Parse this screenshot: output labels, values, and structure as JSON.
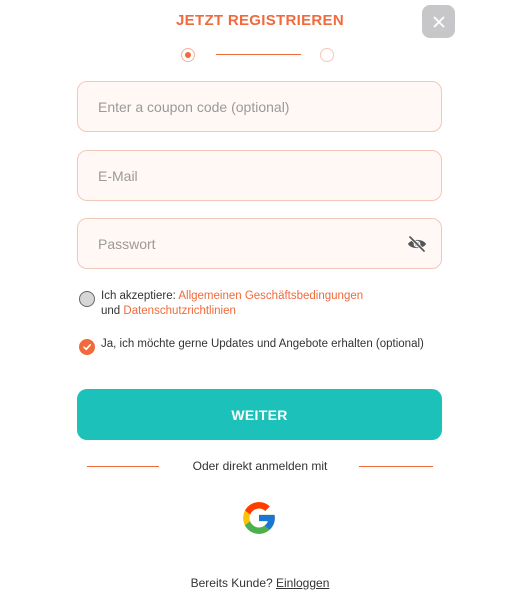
{
  "header": {
    "title": "JETZT REGISTRIEREN"
  },
  "stepper": {
    "current_step": 1,
    "total_steps": 2
  },
  "form": {
    "coupon_placeholder": "Enter a coupon code (optional)",
    "email_placeholder": "E-Mail",
    "password_placeholder": "Passwort"
  },
  "consents": {
    "terms": {
      "prefix": "Ich akzeptiere: ",
      "terms_link": "Allgemeinen Geschäftsbedingungen",
      "connector": "und ",
      "privacy_link": "Datenschutzrichtlinien",
      "checked": false
    },
    "newsletter": {
      "label": "Ja, ich möchte gerne Updates und Angebote erhalten (optional)",
      "checked": true
    }
  },
  "actions": {
    "next_label": "WEITER"
  },
  "social": {
    "divider_text": "Oder direkt anmelden mit",
    "google_icon": "google-icon"
  },
  "footer": {
    "question": "Bereits Kunde? ",
    "login_link": "Einloggen"
  },
  "colors": {
    "accent": "#f06a3c",
    "primary_button": "#1cc1b9",
    "field_bg": "#fff8f5",
    "field_border": "#f2c8b8"
  }
}
